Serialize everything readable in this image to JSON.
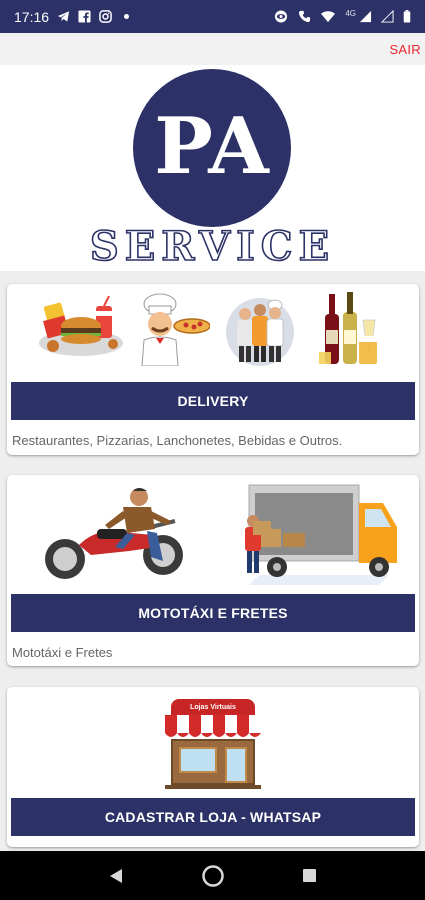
{
  "status_bar": {
    "time": "17:16",
    "network": "4G"
  },
  "header": {
    "logout_label": "SAIR"
  },
  "logo": {
    "initials": "PA",
    "wordmark": "SERVICE"
  },
  "cards": [
    {
      "button_label": "DELIVERY",
      "description": "Restaurantes, Pizzarias, Lanchonetes, Bebidas e Outros."
    },
    {
      "button_label": "MOTOTÁXI E FRETES",
      "description": "Mototáxi e Fretes"
    },
    {
      "button_label": "CADASTRAR  LOJA - WHATSAP",
      "store_sign": "Lojas Virtuais"
    }
  ],
  "colors": {
    "brand_navy": "#2c3267",
    "logout_red": "#e8262a"
  },
  "icons": [
    "telegram-icon",
    "facebook-icon",
    "instagram-icon",
    "eye-icon",
    "wifi-icon",
    "signal-icon",
    "battery-icon",
    "back-icon",
    "home-icon",
    "recents-icon"
  ]
}
